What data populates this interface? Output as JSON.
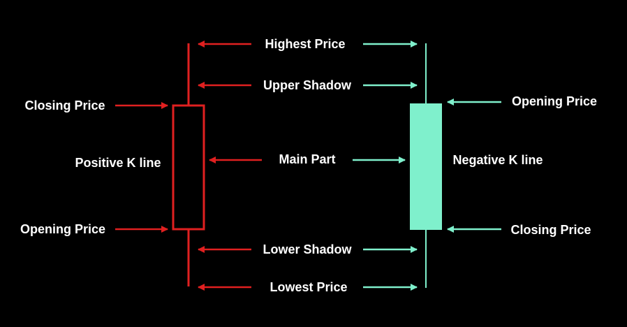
{
  "colors": {
    "background": "#000000",
    "positive": "#e02020",
    "negative": "#7ff0cc",
    "text": "#ffffff"
  },
  "labels": {
    "highest_price": "Highest Price",
    "upper_shadow": "Upper Shadow",
    "main_part": "Main Part",
    "lower_shadow": "Lower Shadow",
    "lowest_price": "Lowest Price",
    "positive_closing_price": "Closing Price",
    "positive_opening_price": "Opening Price",
    "positive_k_line": "Positive K line",
    "negative_opening_price": "Opening Price",
    "negative_closing_price": "Closing Price",
    "negative_k_line": "Negative K line"
  }
}
